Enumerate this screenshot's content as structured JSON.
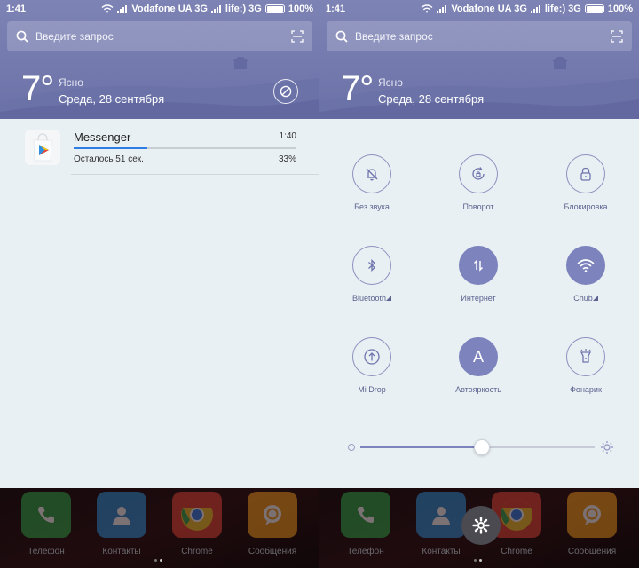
{
  "status": {
    "time": "1:41",
    "carrier1": "Vodafone UA 3G",
    "carrier2": "life:) 3G",
    "battery": "100%"
  },
  "search": {
    "placeholder": "Введите запрос"
  },
  "weather": {
    "temp": "7°",
    "condition": "Ясно",
    "date": "Среда, 28 сентября"
  },
  "notification": {
    "app": "Messenger",
    "time": "1:40",
    "remaining": "Осталось 51 сек.",
    "percent": "33%",
    "progress": 0.33
  },
  "toggles": [
    {
      "label": "Без звука",
      "icon": "bell-off-icon",
      "on": false
    },
    {
      "label": "Поворот",
      "icon": "rotate-lock-icon",
      "on": false
    },
    {
      "label": "Блокировка",
      "icon": "lock-icon",
      "on": false
    },
    {
      "label": "Bluetooth",
      "icon": "bluetooth-icon",
      "on": false,
      "signal": true
    },
    {
      "label": "Интернет",
      "icon": "data-transfer-icon",
      "on": true
    },
    {
      "label": "Chub",
      "icon": "wifi-icon",
      "on": true,
      "signal": true
    },
    {
      "label": "Mi Drop",
      "icon": "mi-drop-icon",
      "on": false
    },
    {
      "label": "Автояркость",
      "icon": "auto-brightness-icon",
      "on": true,
      "glyph": "A"
    },
    {
      "label": "Фонарик",
      "icon": "flashlight-icon",
      "on": false
    }
  ],
  "brightness": 0.52,
  "dock": [
    {
      "label": "Телефон",
      "icon": "phone-icon",
      "color": "#2fa84a"
    },
    {
      "label": "Контакты",
      "icon": "contacts-icon",
      "color": "#2d8fd6"
    },
    {
      "label": "Chrome",
      "icon": "chrome-icon",
      "color": "#e04335"
    },
    {
      "label": "Сообщения",
      "icon": "messages-icon",
      "color": "#f29b1d"
    }
  ],
  "colors": {
    "header": "#7379ad",
    "accent": "#7c83bd",
    "sheet": "#e9f0f3",
    "progress": "#2f7ee6"
  }
}
